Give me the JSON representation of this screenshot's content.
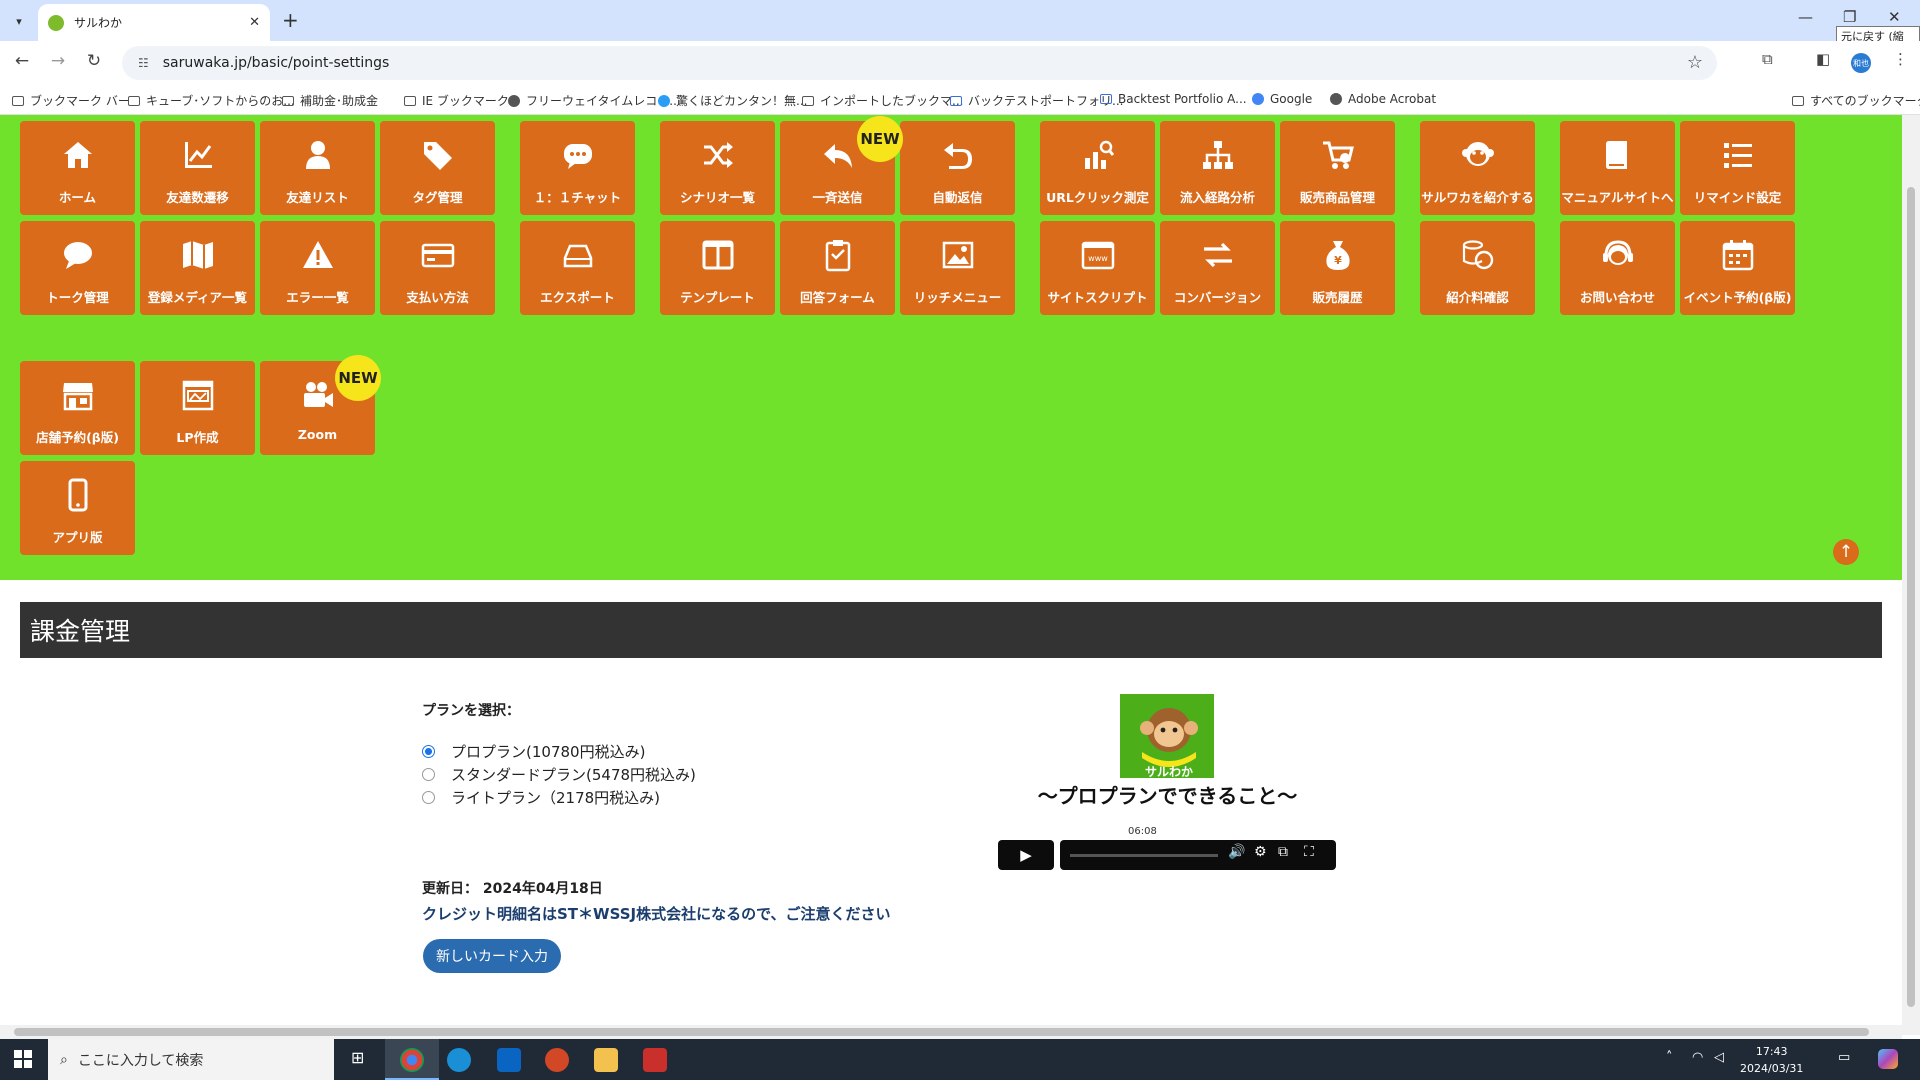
{
  "browser": {
    "tab_title": "サルわか",
    "url": "saruwaka.jp/basic/point-settings",
    "restore_tooltip": "元に戻す (縮小)",
    "bookmarks": [
      "ブックマーク バー",
      "キューブ･ソフトからのお...",
      "補助金･助成金",
      "IE ブックマーク",
      "フリーウェイタイムレコー...",
      "驚くほどカンタン！無...",
      "インポートしたブックマ...",
      "バックテストポートフォリ...",
      "Backtest Portfolio A...",
      "Google",
      "Adobe Acrobat"
    ],
    "all_bookmarks": "すべてのブックマーク",
    "profile_initials": "和也"
  },
  "menu": {
    "new_badge": "NEW",
    "tiles": [
      {
        "label": "ホーム",
        "icon": "home-icon"
      },
      {
        "label": "友達数遷移",
        "icon": "line-chart-icon"
      },
      {
        "label": "友達リスト",
        "icon": "user-icon"
      },
      {
        "label": "タグ管理",
        "icon": "tags-icon"
      },
      {
        "label": "１：１チャット",
        "icon": "chat-icon"
      },
      {
        "label": "シナリオ一覧",
        "icon": "shuffle-icon"
      },
      {
        "label": "一斉送信",
        "icon": "reply-icon"
      },
      {
        "label": "自動返信",
        "icon": "undo-icon"
      },
      {
        "label": "URLクリック測定",
        "icon": "click-chart-icon"
      },
      {
        "label": "流入経路分析",
        "icon": "sitemap-icon"
      },
      {
        "label": "販売商品管理",
        "icon": "cart-icon"
      },
      {
        "label": "サルワカを紹介する",
        "icon": "monkey-icon"
      },
      {
        "label": "マニュアルサイトへ",
        "icon": "book-icon"
      },
      {
        "label": "リマインド設定",
        "icon": "list-icon"
      },
      {
        "label": "トーク管理",
        "icon": "comment-icon"
      },
      {
        "label": "登録メディア一覧",
        "icon": "map-icon"
      },
      {
        "label": "エラー一覧",
        "icon": "warning-icon"
      },
      {
        "label": "支払い方法",
        "icon": "credit-card-icon"
      },
      {
        "label": "エクスポート",
        "icon": "drive-icon"
      },
      {
        "label": "テンプレート",
        "icon": "columns-icon"
      },
      {
        "label": "回答フォーム",
        "icon": "clipboard-icon"
      },
      {
        "label": "リッチメニュー",
        "icon": "image-icon"
      },
      {
        "label": "サイトスクリプト",
        "icon": "browser-www-icon"
      },
      {
        "label": "コンバージョン",
        "icon": "exchange-icon"
      },
      {
        "label": "販売履歴",
        "icon": "money-bag-icon"
      },
      {
        "label": "紹介料確認",
        "icon": "coins-icon"
      },
      {
        "label": "お問い合わせ",
        "icon": "headset-icon"
      },
      {
        "label": "イベント予約(β版)",
        "icon": "calendar-icon"
      },
      {
        "label": "店舗予約(β版)",
        "icon": "store-icon"
      },
      {
        "label": "LP作成",
        "icon": "webpage-icon"
      },
      {
        "label": "Zoom",
        "icon": "video-camera-icon"
      },
      {
        "label": "アプリ版",
        "icon": "mobile-icon"
      }
    ]
  },
  "billing": {
    "section_title": "課金管理",
    "plan_select_label": "プランを選択：",
    "plans": [
      {
        "label": "プロプラン(10780円税込み)",
        "selected": true
      },
      {
        "label": "スタンダードプラン(5478円税込み)",
        "selected": false
      },
      {
        "label": "ライトプラン（2178円税込み)",
        "selected": false
      }
    ],
    "updated": "更新日： 2024年04月18日",
    "notice": "クレジット明細名はST＊WSSJ株式会社になるので、ご注意ください",
    "new_card_button": "新しいカード入力",
    "video": {
      "logo_text": "サルわか",
      "caption": "～プロプランでできること～",
      "time": "06:08"
    }
  },
  "taskbar": {
    "search_placeholder": "ここに入力して検索",
    "time": "17:43",
    "date": "2024/03/31"
  },
  "colors": {
    "green_bg": "#71e22b",
    "tile": "#d96b1b",
    "badge": "#f7e51b",
    "section_bar": "#333333",
    "button": "#2b6cb0"
  }
}
